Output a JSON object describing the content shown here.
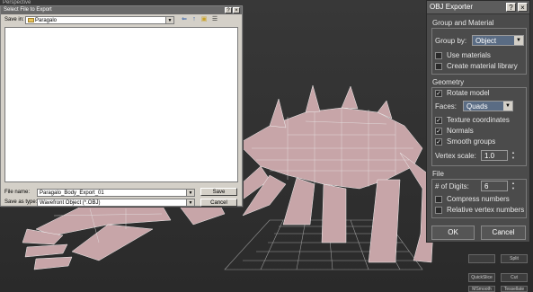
{
  "viewport": {
    "label": "Perspective"
  },
  "file_dialog": {
    "title": "Select File to Export",
    "save_in_label": "Save in:",
    "save_in_value": "Paragalo",
    "file_name_label": "File name:",
    "file_name_value": "Paragalo_Body_Export_01",
    "save_as_type_label": "Save as type:",
    "save_as_type_value": "Wavefront Object (*.OBJ)",
    "save_button": "Save",
    "cancel_button": "Cancel"
  },
  "obj_exporter": {
    "title": "OBJ Exporter",
    "group_material": {
      "title": "Group and Material",
      "group_by_label": "Group by:",
      "group_by_value": "Object",
      "use_materials": {
        "label": "Use materials",
        "checked": false
      },
      "create_library": {
        "label": "Create material library",
        "checked": false
      }
    },
    "geometry": {
      "title": "Geometry",
      "rotate_model": {
        "label": "Rotate model",
        "checked": true
      },
      "faces_label": "Faces:",
      "faces_value": "Quads",
      "texture_coords": {
        "label": "Texture coordinates",
        "checked": true
      },
      "normals": {
        "label": "Normals",
        "checked": true
      },
      "smooth_groups": {
        "label": "Smooth groups",
        "checked": true
      },
      "vertex_scale_label": "Vertex scale:",
      "vertex_scale_value": "1.0"
    },
    "file": {
      "title": "File",
      "digits_label": "# of Digits:",
      "digits_value": "6",
      "compress_numbers": {
        "label": "Compress numbers",
        "checked": false
      },
      "relative_vertex": {
        "label": "Relative vertex numbers",
        "checked": false
      }
    },
    "ok_button": "OK",
    "cancel_button": "Cancel"
  },
  "side_toolbar": {
    "split": "Split",
    "quickslice": "QuickSlice",
    "cut": "Cut",
    "msmooth": "MSmooth",
    "tessellate": "Tessellate"
  },
  "colors": {
    "dialog_bg": "#4b4b4b",
    "model_pink": "#c8a4a8",
    "grid": "#8a8a8a"
  }
}
